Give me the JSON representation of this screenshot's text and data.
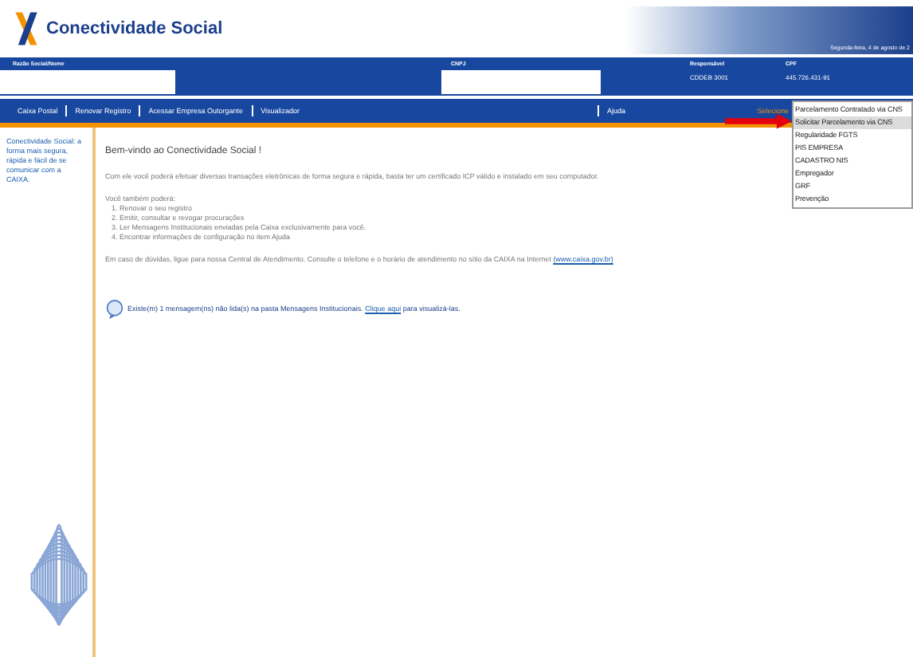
{
  "header": {
    "title": "Conectividade Social",
    "date": "Segunda-feira, 4 de agosto de 2"
  },
  "info_bar": [
    {
      "label": "Razão Social/Nome",
      "redacted": true
    },
    {
      "label": "CNPJ",
      "redacted": true
    },
    {
      "label": "Responsável",
      "value": "CDDEB 3001",
      "redacted": false
    },
    {
      "label": "CPF",
      "value": "445.726.431-91",
      "redacted": false
    }
  ],
  "nav": {
    "items": [
      "Caixa Postal",
      "Renovar Registro",
      "Acessar Empresa Outorgante",
      "Visualizador"
    ],
    "help": "Ajuda",
    "select": "Selecione"
  },
  "menu": [
    {
      "label": "Parcelamento Contratado via CNS",
      "selected": false
    },
    {
      "label": "Solicitar Parcelamento via CNS",
      "selected": true
    },
    {
      "label": "Regularidade FGTS",
      "selected": false
    },
    {
      "label": "PIS EMPRESA",
      "selected": false
    },
    {
      "label": "CADASTRO NIS",
      "selected": false
    },
    {
      "label": "Empregador",
      "selected": false
    },
    {
      "label": "GRF",
      "selected": false
    },
    {
      "label": "Prevenção",
      "selected": false
    }
  ],
  "sidebar": {
    "text": "Conectividade Social: a forma mais segura, rápida e fácil de se comunicar com a CAIXA."
  },
  "main": {
    "title": "Bem-vindo ao Conectividade Social !",
    "intro": "Com ele você poderá efetuar diversas transações eletrônicas de forma segura e rápida, basta ter um certificado ICP válido e instalado em seu computador.",
    "also": "Você também poderá:",
    "list": [
      "1. Renovar o seu registro",
      "2. Emitir, consultar e revogar procurações",
      "3. Ler Mensagens Institucionais enviadas pela Caixa exclusivamente para você.",
      "4. Encontrar informações de configuração no item Ajuda"
    ],
    "help_text": "Em caso de dúvidas, ligue para nossa Central de Atendimento. Consulte o telefone e o horário de atendimento no sítio da CAIXA na Internet",
    "help_link": "(www.caixa.gov.br)",
    "message": "Existe(m) 1 mensagem(ns) não lida(s) na pasta Mensagens Institucionais.",
    "message_link": "Clique aqui",
    "message_end": "para visualizá-las."
  }
}
